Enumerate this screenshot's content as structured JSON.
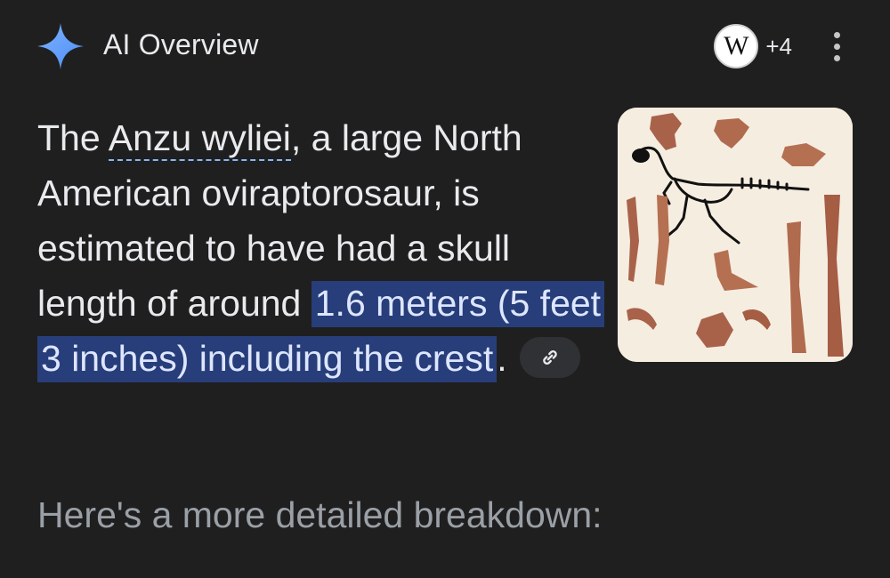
{
  "header": {
    "title": "AI Overview",
    "icon": "sparkle-icon",
    "source_icon": "wikipedia-icon",
    "source_icon_letter": "W",
    "source_count": "+4",
    "menu_icon": "more-vert-icon"
  },
  "answer": {
    "part1": "The ",
    "entity": "Anzu wyliei",
    "part2": ", a large North American oviraptorosaur, is estimated to have had a skull length of around ",
    "highlight": "1.6 meters (5 feet 3 inches) including the crest",
    "part3": ".",
    "link_icon": "link-icon"
  },
  "thumbnail": {
    "subject": "oviraptorosaur skeleton and bones illustration"
  },
  "breakdown_heading": "Here's a more detailed breakdown:",
  "colors": {
    "background": "#1f1f1f",
    "highlight_bg": "#283e7a",
    "accent_blue": "#8ab4f8",
    "muted_text": "#9aa0a6"
  }
}
